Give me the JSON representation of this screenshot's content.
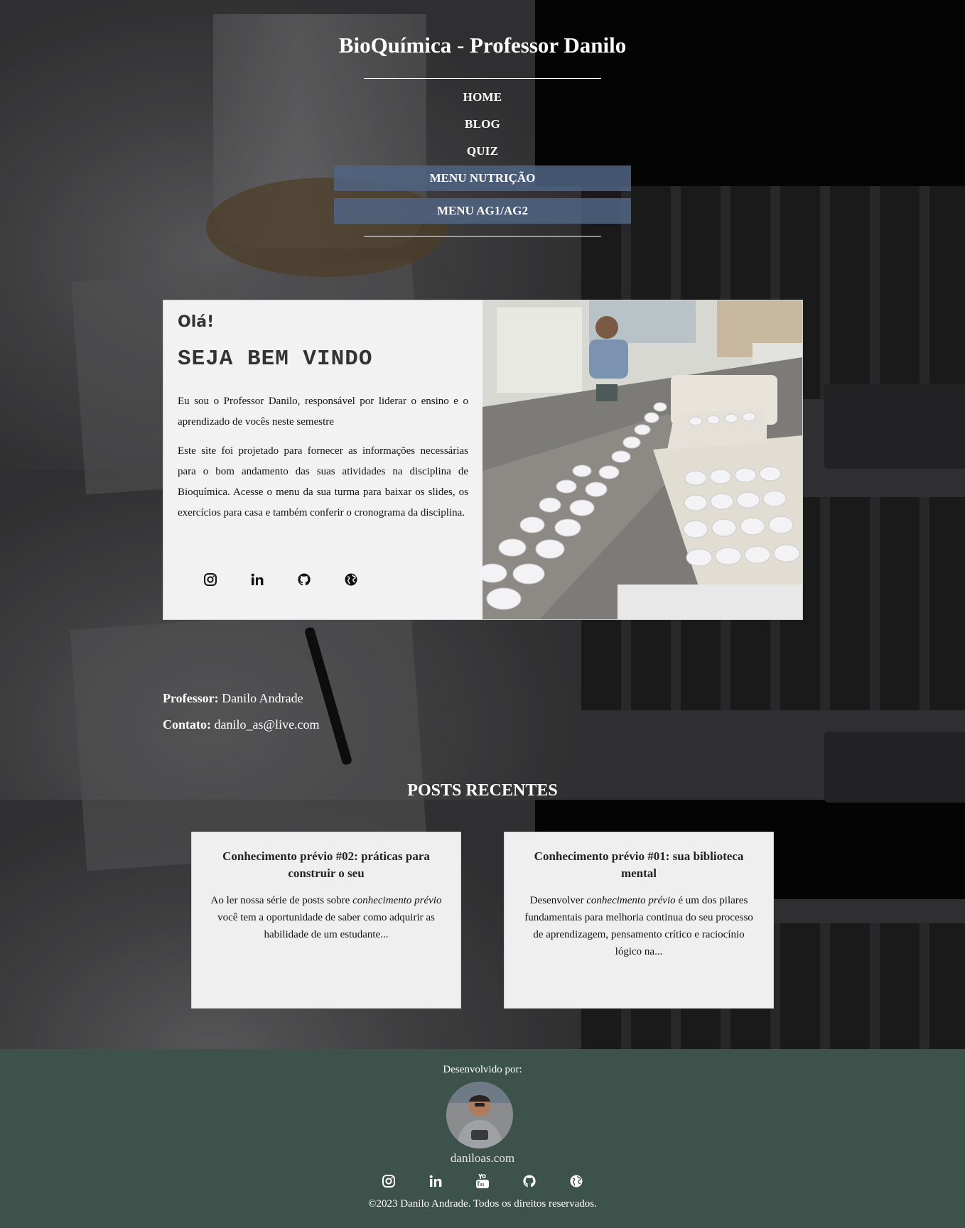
{
  "header": {
    "title": "BioQuímica - Professor Danilo",
    "nav": {
      "home": "HOME",
      "blog": "BLOG",
      "quiz": "QUIZ",
      "menu_nutricao": "MENU NUTRIÇÃO",
      "menu_ag": "MENU AG1/AG2"
    }
  },
  "welcome": {
    "greeting": "Olá!",
    "heading": "SEJA BEM VINDO",
    "paragraph1": "Eu sou o Professor Danilo, responsável por liderar o ensino e o aprendizado de vocês neste semestre",
    "paragraph2": "Este site foi projetado para fornecer as informações necessárias para o bom andamento das suas atividades na disciplina de Bioquímica. Acesse o menu da sua turma para baixar os slides, os exercícios para casa e também conferir o cronograma da disciplina.",
    "social_icons": [
      "instagram-icon",
      "linkedin-icon",
      "github-icon",
      "globe-icon"
    ]
  },
  "contact": {
    "professor_label": "Professor:",
    "professor_name": "Danilo Andrade",
    "contact_label": "Contato:",
    "email": "danilo_as@live.com"
  },
  "posts": {
    "section_title": "POSTS RECENTES",
    "items": [
      {
        "title": "Conhecimento prévio #02: práticas para construir o seu",
        "excerpt_before": "Ao ler nossa série de posts sobre ",
        "excerpt_em": "conhecimento prévio",
        "excerpt_after": " você tem a oportunidade de saber como adquirir as habilidade de um estudante..."
      },
      {
        "title": "Conhecimento prévio #01: sua biblioteca mental",
        "excerpt_before": "Desenvolver ",
        "excerpt_em": "conhecimento prévio",
        "excerpt_after": " é um dos pilares fundamentais para melhoria continua do seu processo de aprendizagem, pensamento crítico e raciocínio lógico na..."
      }
    ]
  },
  "footer": {
    "developed_by": "Desenvolvido por:",
    "site": "daniloas.com",
    "social_icons": [
      "instagram-icon",
      "linkedin-icon",
      "youtube-icon",
      "github-icon",
      "globe-icon"
    ],
    "copyright": "©2023 Danilo Andrade. Todos os direitos reservados."
  },
  "colors": {
    "nav_button_bg": "#50648a",
    "card_bg": "#f2f2f2",
    "footer_bg": "#3d524a",
    "text_dark": "#222222"
  }
}
